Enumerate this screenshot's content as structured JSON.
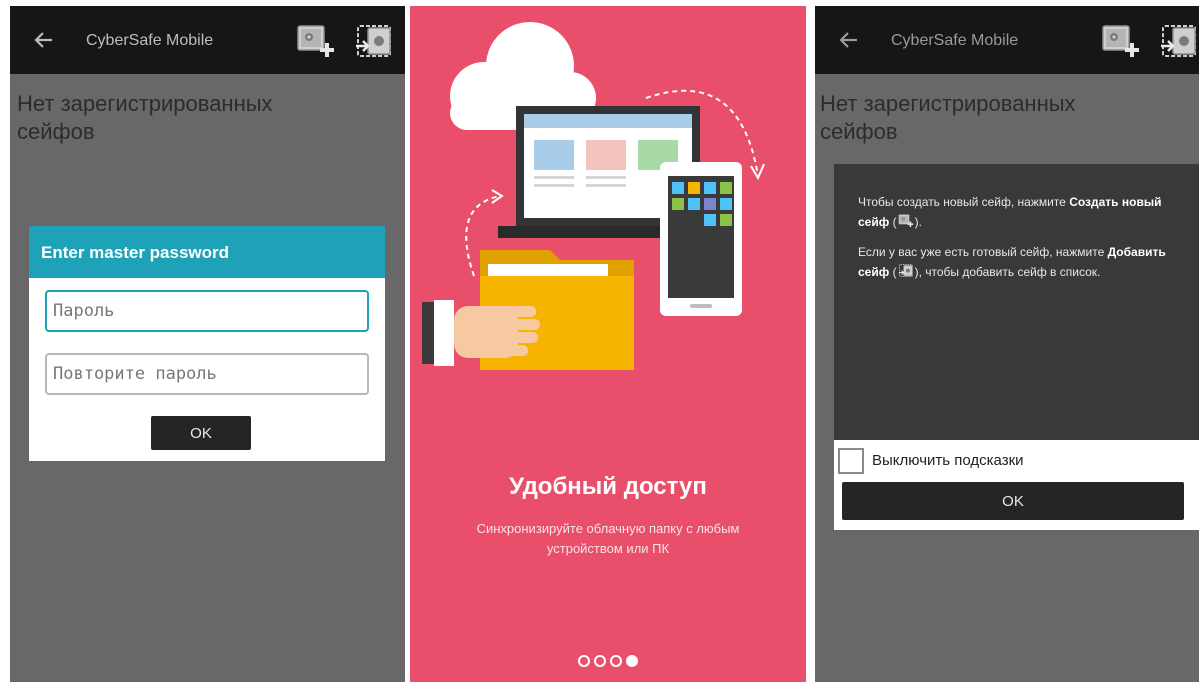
{
  "screen1": {
    "appbar": {
      "title": "CyberSafe Mobile",
      "back_icon": "arrow-left-icon",
      "icon_create": "safe-add-icon",
      "icon_add": "safe-import-icon"
    },
    "empty_text": "Нет зарегистрированных сейфов",
    "dialog": {
      "title": "Enter master password",
      "password_placeholder": "Пароль",
      "repeat_placeholder": "Повторите пароль",
      "ok_label": "OK"
    }
  },
  "screen2": {
    "title": "Удобный доступ",
    "subtitle": "Синхронизируйте облачную папку с любым устройством или ПК",
    "page_count": 4,
    "active_page": 4,
    "colors": {
      "background": "#e94e6a",
      "folder": "#f6b300"
    }
  },
  "screen3": {
    "appbar": {
      "title": "CyberSafe Mobile"
    },
    "empty_text": "Нет зарегистрированных сейфов",
    "hint": {
      "p1_before": "Чтобы создать новый сейф, нажмите ",
      "p1_bold": "Создать новый сейф",
      "p1_open": " (",
      "p1_after": ").",
      "p2_before": "Если у вас уже есть готовый сейф, нажмите ",
      "p2_bold": "Добавить сейф",
      "p2_open": " (",
      "p2_after": "), чтобы добавить сейф в список."
    },
    "checkbox_label": "Выключить подсказки",
    "ok_label": "OK"
  },
  "colors": {
    "actionbar": "#161616",
    "dialog_header": "#1ea2b8",
    "screen_bg": "#686868"
  }
}
